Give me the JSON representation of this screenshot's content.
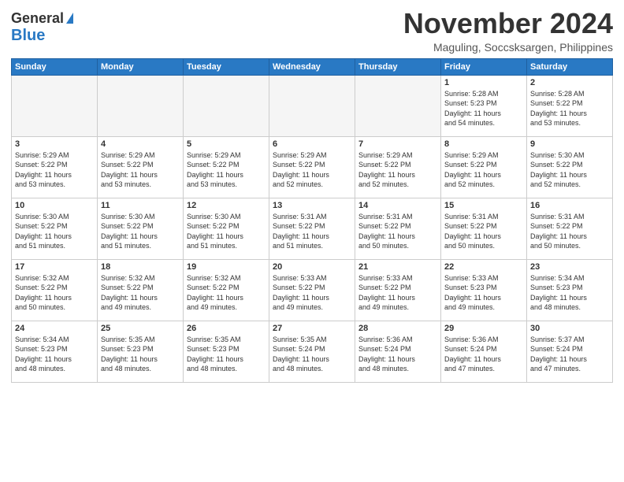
{
  "logo": {
    "line1": "General",
    "line2": "Blue"
  },
  "title": "November 2024",
  "location": "Maguling, Soccsksargen, Philippines",
  "weekdays": [
    "Sunday",
    "Monday",
    "Tuesday",
    "Wednesday",
    "Thursday",
    "Friday",
    "Saturday"
  ],
  "weeks": [
    [
      {
        "day": "",
        "info": "",
        "empty": true
      },
      {
        "day": "",
        "info": "",
        "empty": true
      },
      {
        "day": "",
        "info": "",
        "empty": true
      },
      {
        "day": "",
        "info": "",
        "empty": true
      },
      {
        "day": "",
        "info": "",
        "empty": true
      },
      {
        "day": "1",
        "info": "Sunrise: 5:28 AM\nSunset: 5:23 PM\nDaylight: 11 hours\nand 54 minutes."
      },
      {
        "day": "2",
        "info": "Sunrise: 5:28 AM\nSunset: 5:22 PM\nDaylight: 11 hours\nand 53 minutes."
      }
    ],
    [
      {
        "day": "3",
        "info": "Sunrise: 5:29 AM\nSunset: 5:22 PM\nDaylight: 11 hours\nand 53 minutes."
      },
      {
        "day": "4",
        "info": "Sunrise: 5:29 AM\nSunset: 5:22 PM\nDaylight: 11 hours\nand 53 minutes."
      },
      {
        "day": "5",
        "info": "Sunrise: 5:29 AM\nSunset: 5:22 PM\nDaylight: 11 hours\nand 53 minutes."
      },
      {
        "day": "6",
        "info": "Sunrise: 5:29 AM\nSunset: 5:22 PM\nDaylight: 11 hours\nand 52 minutes."
      },
      {
        "day": "7",
        "info": "Sunrise: 5:29 AM\nSunset: 5:22 PM\nDaylight: 11 hours\nand 52 minutes."
      },
      {
        "day": "8",
        "info": "Sunrise: 5:29 AM\nSunset: 5:22 PM\nDaylight: 11 hours\nand 52 minutes."
      },
      {
        "day": "9",
        "info": "Sunrise: 5:30 AM\nSunset: 5:22 PM\nDaylight: 11 hours\nand 52 minutes."
      }
    ],
    [
      {
        "day": "10",
        "info": "Sunrise: 5:30 AM\nSunset: 5:22 PM\nDaylight: 11 hours\nand 51 minutes."
      },
      {
        "day": "11",
        "info": "Sunrise: 5:30 AM\nSunset: 5:22 PM\nDaylight: 11 hours\nand 51 minutes."
      },
      {
        "day": "12",
        "info": "Sunrise: 5:30 AM\nSunset: 5:22 PM\nDaylight: 11 hours\nand 51 minutes."
      },
      {
        "day": "13",
        "info": "Sunrise: 5:31 AM\nSunset: 5:22 PM\nDaylight: 11 hours\nand 51 minutes."
      },
      {
        "day": "14",
        "info": "Sunrise: 5:31 AM\nSunset: 5:22 PM\nDaylight: 11 hours\nand 50 minutes."
      },
      {
        "day": "15",
        "info": "Sunrise: 5:31 AM\nSunset: 5:22 PM\nDaylight: 11 hours\nand 50 minutes."
      },
      {
        "day": "16",
        "info": "Sunrise: 5:31 AM\nSunset: 5:22 PM\nDaylight: 11 hours\nand 50 minutes."
      }
    ],
    [
      {
        "day": "17",
        "info": "Sunrise: 5:32 AM\nSunset: 5:22 PM\nDaylight: 11 hours\nand 50 minutes."
      },
      {
        "day": "18",
        "info": "Sunrise: 5:32 AM\nSunset: 5:22 PM\nDaylight: 11 hours\nand 49 minutes."
      },
      {
        "day": "19",
        "info": "Sunrise: 5:32 AM\nSunset: 5:22 PM\nDaylight: 11 hours\nand 49 minutes."
      },
      {
        "day": "20",
        "info": "Sunrise: 5:33 AM\nSunset: 5:22 PM\nDaylight: 11 hours\nand 49 minutes."
      },
      {
        "day": "21",
        "info": "Sunrise: 5:33 AM\nSunset: 5:22 PM\nDaylight: 11 hours\nand 49 minutes."
      },
      {
        "day": "22",
        "info": "Sunrise: 5:33 AM\nSunset: 5:23 PM\nDaylight: 11 hours\nand 49 minutes."
      },
      {
        "day": "23",
        "info": "Sunrise: 5:34 AM\nSunset: 5:23 PM\nDaylight: 11 hours\nand 48 minutes."
      }
    ],
    [
      {
        "day": "24",
        "info": "Sunrise: 5:34 AM\nSunset: 5:23 PM\nDaylight: 11 hours\nand 48 minutes."
      },
      {
        "day": "25",
        "info": "Sunrise: 5:35 AM\nSunset: 5:23 PM\nDaylight: 11 hours\nand 48 minutes."
      },
      {
        "day": "26",
        "info": "Sunrise: 5:35 AM\nSunset: 5:23 PM\nDaylight: 11 hours\nand 48 minutes."
      },
      {
        "day": "27",
        "info": "Sunrise: 5:35 AM\nSunset: 5:24 PM\nDaylight: 11 hours\nand 48 minutes."
      },
      {
        "day": "28",
        "info": "Sunrise: 5:36 AM\nSunset: 5:24 PM\nDaylight: 11 hours\nand 48 minutes."
      },
      {
        "day": "29",
        "info": "Sunrise: 5:36 AM\nSunset: 5:24 PM\nDaylight: 11 hours\nand 47 minutes."
      },
      {
        "day": "30",
        "info": "Sunrise: 5:37 AM\nSunset: 5:24 PM\nDaylight: 11 hours\nand 47 minutes."
      }
    ]
  ]
}
